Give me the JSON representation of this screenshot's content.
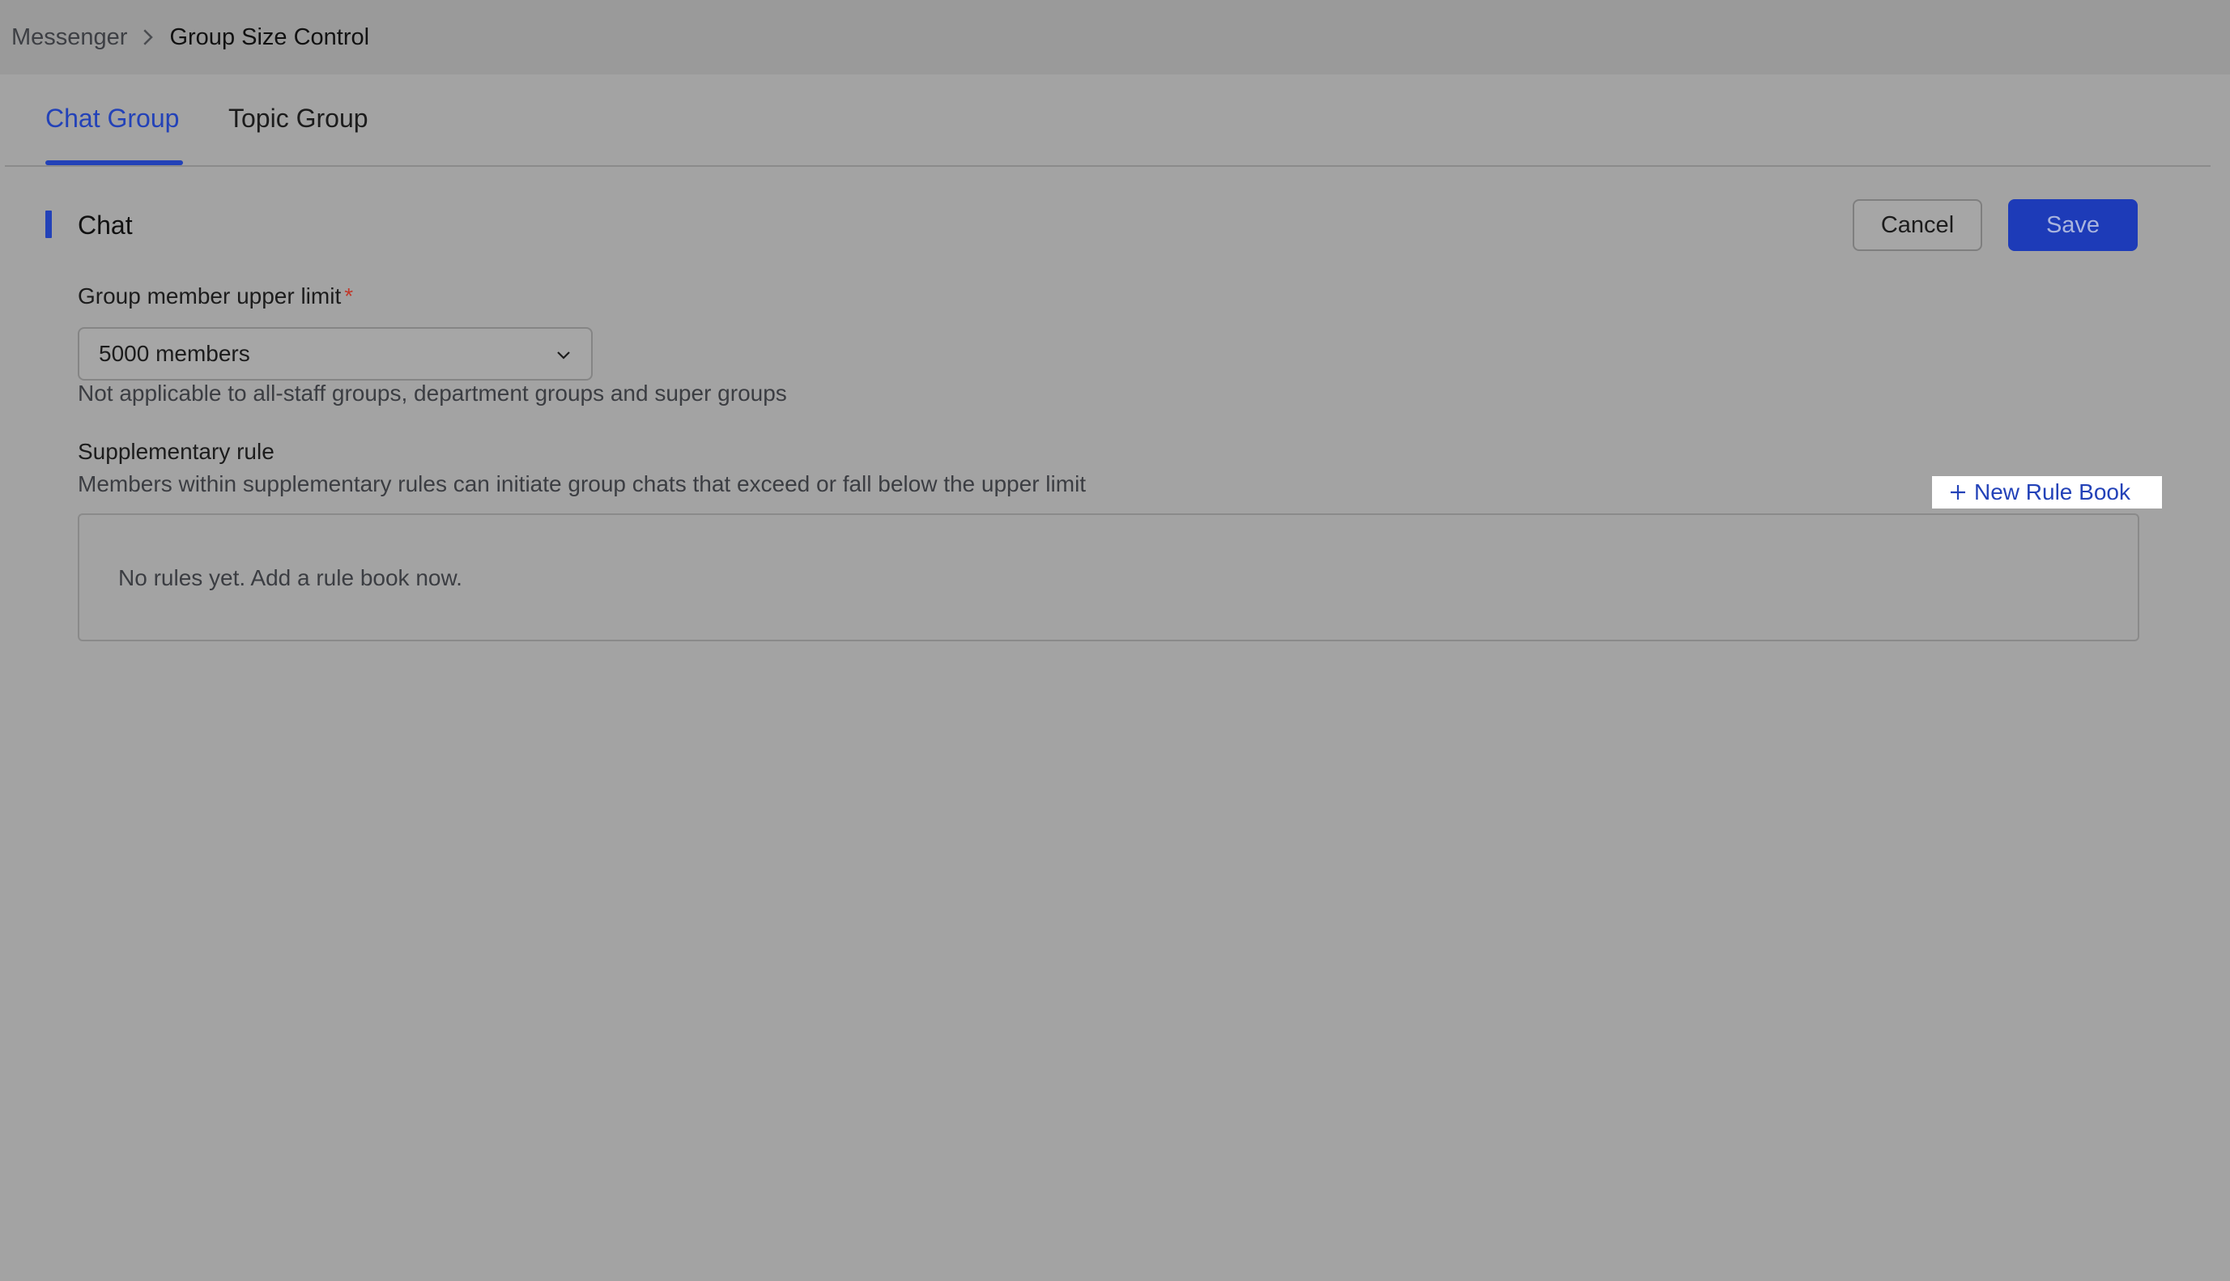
{
  "breadcrumb": {
    "parent": "Messenger",
    "current": "Group Size Control"
  },
  "tabs": [
    {
      "label": "Chat Group",
      "active": true
    },
    {
      "label": "Topic Group",
      "active": false
    }
  ],
  "section": {
    "title": "Chat"
  },
  "actions": {
    "cancel_label": "Cancel",
    "save_label": "Save"
  },
  "form": {
    "limit_label": "Group member upper limit",
    "required_mark": "*",
    "limit_value": "5000 members",
    "limit_hint": "Not applicable to all-staff groups, department groups and super groups",
    "supp_label": "Supplementary rule",
    "supp_desc": "Members within supplementary rules can initiate group chats that exceed or fall below the upper limit",
    "new_rule_label": "New Rule Book",
    "empty_text": "No rules yet. Add a rule book now."
  },
  "colors": {
    "accent": "#2342b8",
    "required": "#c0392b",
    "overlay_background": "#a3a3a3"
  },
  "icons": {
    "breadcrumb_separator": "chevron-right-icon",
    "select_arrow": "chevron-down-icon",
    "add": "plus-icon"
  }
}
